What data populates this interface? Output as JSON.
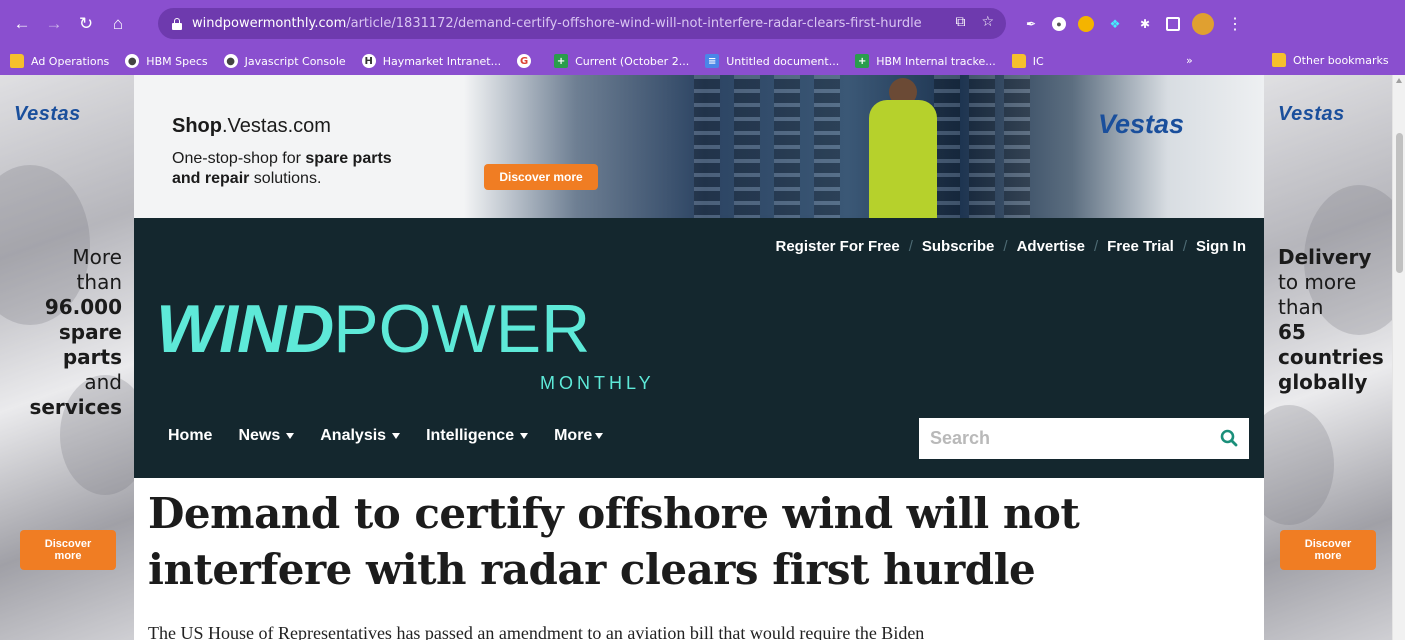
{
  "browser": {
    "url_domain": "windpowermonthly.com",
    "url_path": "/article/1831172/demand-certify-offshore-wind-will-not-interfere-radar-clears-first-hurdle",
    "bookmarks": [
      {
        "label": "Ad Operations",
        "icon": "folder-icon"
      },
      {
        "label": "HBM Specs",
        "icon": "globe-icon"
      },
      {
        "label": "Javascript Console",
        "icon": "globe-icon"
      },
      {
        "label": "Haymarket Intranet...",
        "icon": "haymarket-icon"
      },
      {
        "label": "",
        "icon": "google-icon"
      },
      {
        "label": "Current (October 2...",
        "icon": "sheets-icon"
      },
      {
        "label": "Untitled document...",
        "icon": "docs-icon"
      },
      {
        "label": "HBM Internal tracke...",
        "icon": "sheets-icon"
      },
      {
        "label": "IC",
        "icon": "folder-icon"
      }
    ],
    "overflow": "»",
    "other_bookmarks": "Other bookmarks"
  },
  "ad": {
    "brand": "Vestas",
    "banner_shop_bold": "Shop",
    "banner_shop_rest": ".Vestas.com",
    "banner_line1": "One-stop-shop for ",
    "banner_line1_bold": "spare parts",
    "banner_line2_bold": "and repair",
    "banner_line2": " solutions.",
    "banner_button": "Discover more",
    "left_text": [
      "More",
      "than",
      "96.000",
      "spare",
      "parts",
      "and",
      "services"
    ],
    "right_text": [
      "Delivery",
      "to more",
      "than",
      "65",
      "countries",
      "globally"
    ],
    "skin_button_line1": "Discover",
    "skin_button_line2": "more",
    "colors": {
      "orange": "#f07d23",
      "vestas_blue": "#1a4f9c"
    }
  },
  "site": {
    "topnav": [
      "Register For Free",
      "Subscribe",
      "Advertise",
      "Free Trial",
      "Sign In"
    ],
    "logo_bold": "WIND",
    "logo_rest": "POWER",
    "logo_sub": "MONTHLY",
    "mainnav": [
      {
        "label": "Home",
        "dropdown": false
      },
      {
        "label": "News",
        "dropdown": true
      },
      {
        "label": "Analysis",
        "dropdown": true
      },
      {
        "label": "Intelligence",
        "dropdown": true
      },
      {
        "label": "More",
        "dropdown": true
      }
    ],
    "search_placeholder": "Search",
    "colors": {
      "header_bg": "#14272e",
      "accent": "#5ee9d8",
      "search_icon": "#1a8f7a"
    }
  },
  "article": {
    "headline": "Demand to certify offshore wind will not interfere with radar clears first hurdle",
    "lede": "The US House of Representatives has passed an amendment to an aviation bill that would require the Biden"
  }
}
